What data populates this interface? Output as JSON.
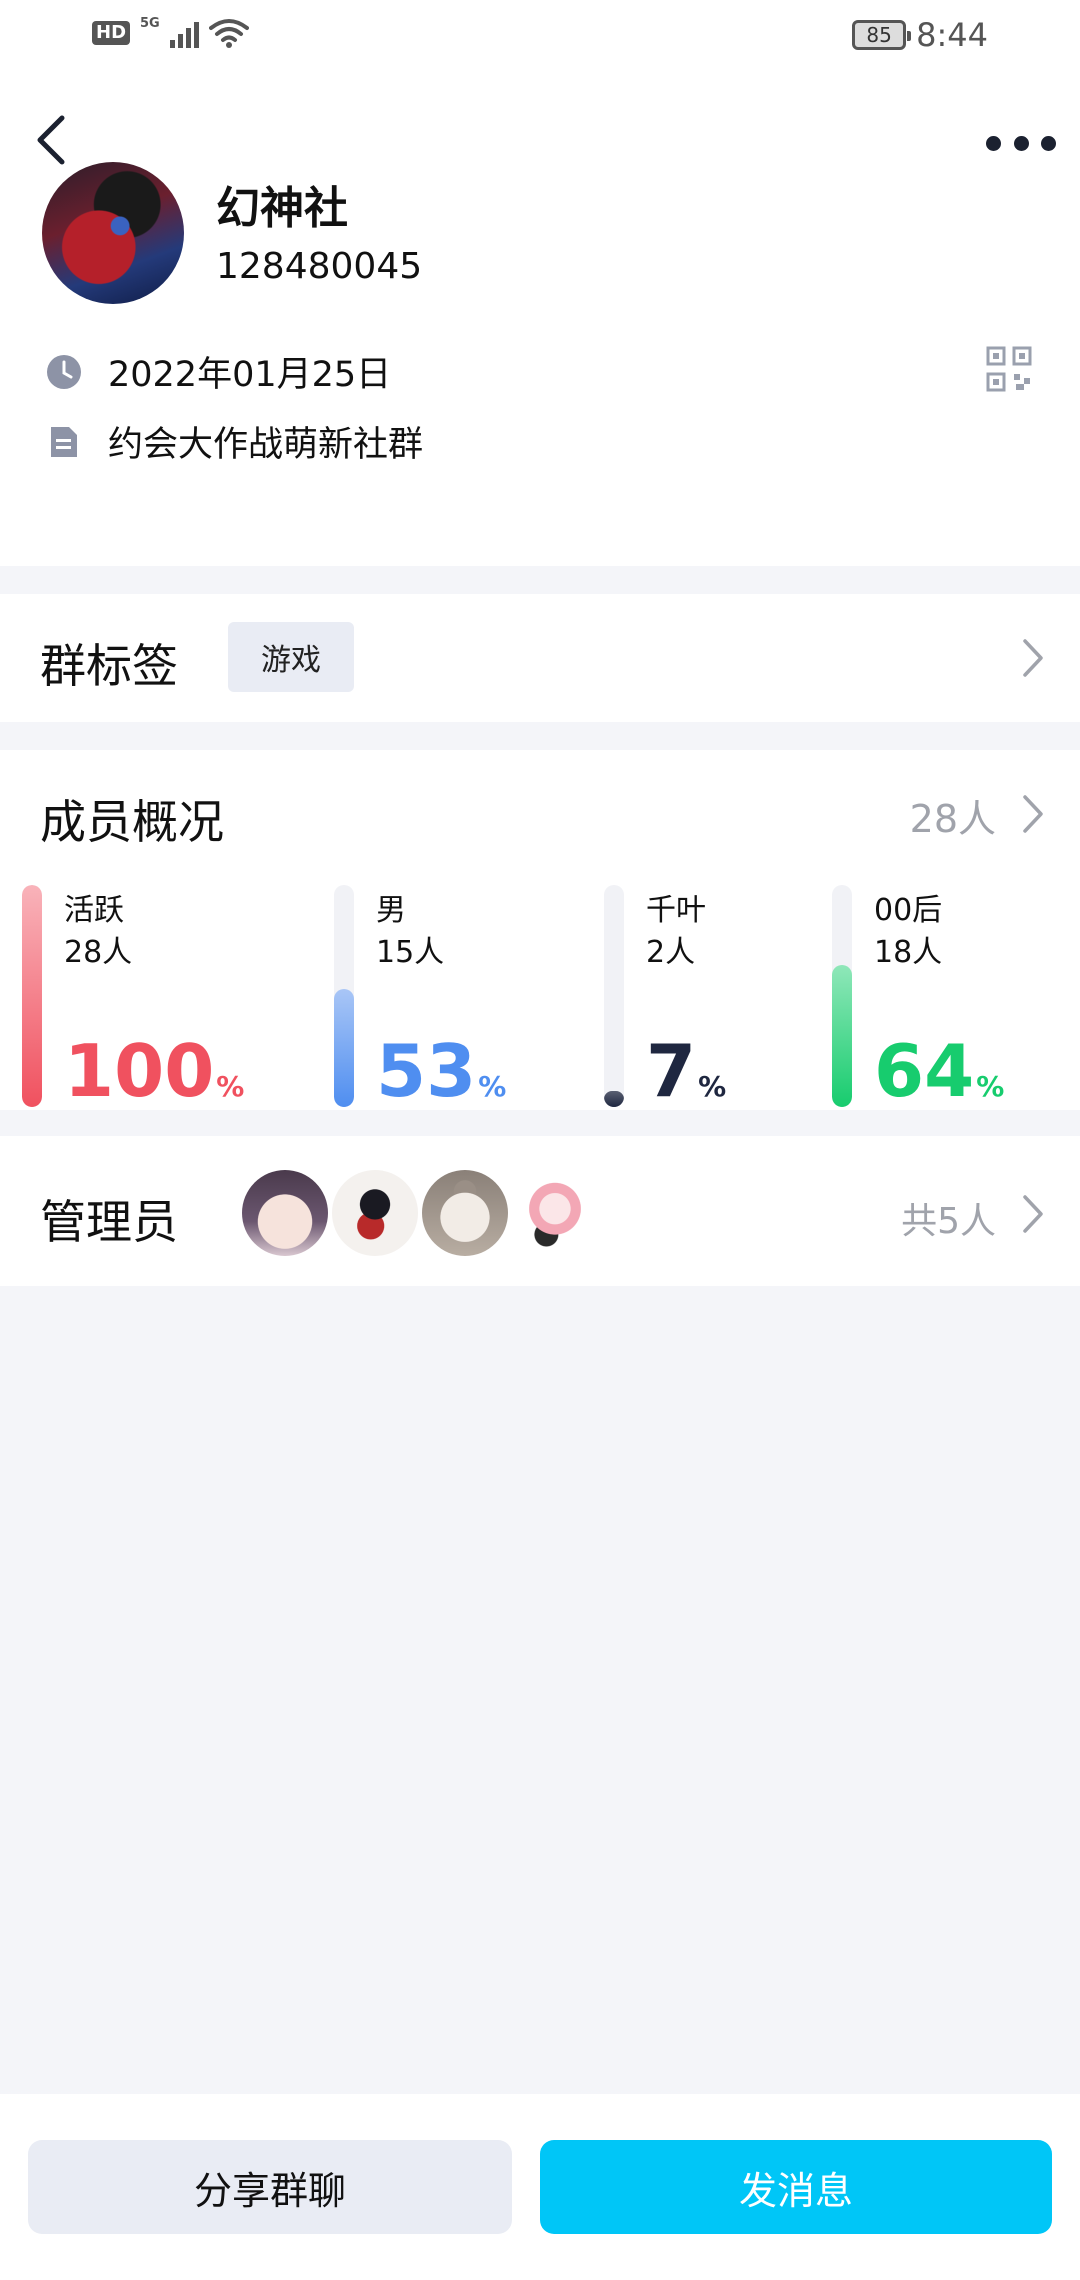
{
  "status_bar": {
    "hd": "HD",
    "network": "5G",
    "battery": "85",
    "time": "8:44"
  },
  "header": {
    "back_icon": "chevron-left-icon",
    "more_icon": "more-dots-icon"
  },
  "group": {
    "name": "幻神社",
    "id": "128480045",
    "created_date": "2022年01月25日",
    "description": "约会大作战萌新社群"
  },
  "tags": {
    "title": "群标签",
    "items": [
      "游戏"
    ]
  },
  "members": {
    "title": "成员概况",
    "count": "28人",
    "stats": [
      {
        "label": "活跃",
        "count": "28人",
        "percent": "100",
        "fraction": 1.0,
        "color": "#f0515f",
        "track_color": "#f9b3ba"
      },
      {
        "label": "男",
        "count": "15人",
        "percent": "53",
        "fraction": 0.53,
        "color": "#4f8ef0",
        "track_color": "#a9c6f6"
      },
      {
        "label": "千叶",
        "count": "2人",
        "percent": "7",
        "fraction": 0.07,
        "color": "#1f2740",
        "track_color": "#5a6072"
      },
      {
        "label": "00后",
        "count": "18人",
        "percent": "64",
        "fraction": 0.64,
        "color": "#17cc6e",
        "track_color": "#8fe7b9"
      }
    ],
    "percent_sign": "%"
  },
  "admins": {
    "title": "管理员",
    "total": "共5人"
  },
  "actions": {
    "share": "分享群聊",
    "send": "发消息"
  }
}
